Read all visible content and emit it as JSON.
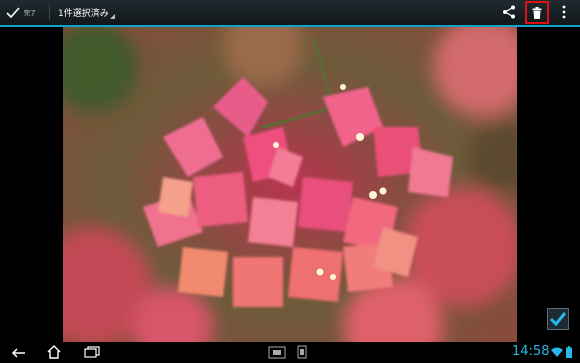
{
  "actionbar": {
    "done_label": "完了",
    "selection_label": "1件選択済み",
    "icons": [
      "check-icon",
      "share-icon",
      "trash-icon",
      "overflow-menu-icon"
    ],
    "highlight_color": "#e01010",
    "accent_color": "#0fa3c8"
  },
  "photo": {
    "subject": "bougainvillea",
    "selected": true
  },
  "navbar": {
    "icons": [
      "back-icon",
      "home-icon",
      "recent-apps-icon",
      "screenshot-icon",
      "settings-icon"
    ]
  },
  "status": {
    "time": "14:58",
    "icons": [
      "wifi-icon",
      "battery-icon"
    ],
    "color": "#27b7e8"
  }
}
